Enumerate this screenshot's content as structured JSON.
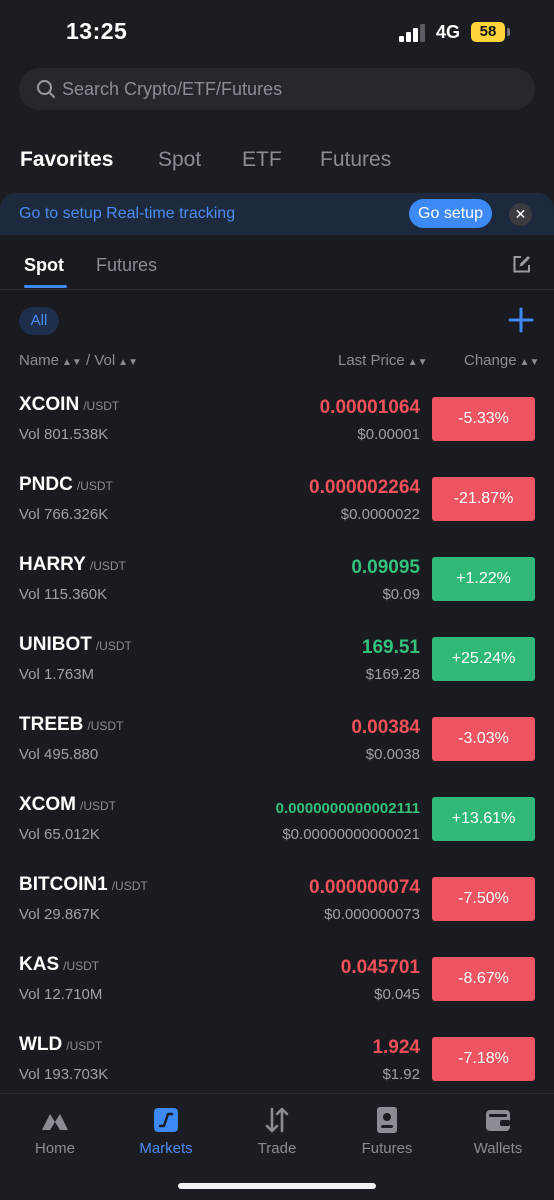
{
  "status": {
    "time": "13:25",
    "network": "4G",
    "battery": "58"
  },
  "search": {
    "placeholder": "Search Crypto/ETF/Futures"
  },
  "top_tabs": [
    {
      "label": "Favorites",
      "active": true
    },
    {
      "label": "Spot"
    },
    {
      "label": "ETF"
    },
    {
      "label": "Futures"
    }
  ],
  "banner": {
    "text": "Go to setup Real-time tracking",
    "button": "Go setup",
    "close": "✕"
  },
  "sub_tabs": [
    {
      "label": "Spot",
      "active": true
    },
    {
      "label": "Futures"
    }
  ],
  "filter": {
    "all": "All"
  },
  "columns": {
    "name": "Name",
    "vol": "/ Vol",
    "last_price": "Last Price",
    "change": "Change"
  },
  "rows": [
    {
      "symbol": "XCOIN",
      "quote": "/USDT",
      "vol": "Vol 801.538K",
      "price": "0.00001064",
      "usd": "$0.00001",
      "change": "-5.33%",
      "direction": "down"
    },
    {
      "symbol": "PNDC",
      "quote": "/USDT",
      "vol": "Vol 766.326K",
      "price": "0.000002264",
      "usd": "$0.0000022",
      "change": "-21.87%",
      "direction": "down"
    },
    {
      "symbol": "HARRY",
      "quote": "/USDT",
      "vol": "Vol 115.360K",
      "price": "0.09095",
      "usd": "$0.09",
      "change": "+1.22%",
      "direction": "up"
    },
    {
      "symbol": "UNIBOT",
      "quote": "/USDT",
      "vol": "Vol 1.763M",
      "price": "169.51",
      "usd": "$169.28",
      "change": "+25.24%",
      "direction": "up"
    },
    {
      "symbol": "TREEB",
      "quote": "/USDT",
      "vol": "Vol 495.880",
      "price": "0.00384",
      "usd": "$0.0038",
      "change": "-3.03%",
      "direction": "down"
    },
    {
      "symbol": "XCOM",
      "quote": "/USDT",
      "vol": "Vol 65.012K",
      "price": "0.0000000000002111",
      "usd": "$0.00000000000021",
      "change": "+13.61%",
      "direction": "up"
    },
    {
      "symbol": "BITCOIN1",
      "quote": "/USDT",
      "vol": "Vol 29.867K",
      "price": "0.000000074",
      "usd": "$0.000000073",
      "change": "-7.50%",
      "direction": "down"
    },
    {
      "symbol": "KAS",
      "quote": "/USDT",
      "vol": "Vol 12.710M",
      "price": "0.045701",
      "usd": "$0.045",
      "change": "-8.67%",
      "direction": "down"
    },
    {
      "symbol": "WLD",
      "quote": "/USDT",
      "vol": "Vol 193.703K",
      "price": "1.924",
      "usd": "$1.92",
      "change": "-7.18%",
      "direction": "down"
    }
  ],
  "nav": [
    {
      "label": "Home",
      "icon": "home-icon"
    },
    {
      "label": "Markets",
      "icon": "markets-icon",
      "active": true
    },
    {
      "label": "Trade",
      "icon": "trade-icon"
    },
    {
      "label": "Futures",
      "icon": "futures-icon"
    },
    {
      "label": "Wallets",
      "icon": "wallet-icon"
    }
  ],
  "colors": {
    "accent": "#3d8af7",
    "up": "#2fb877",
    "down": "#ee5560",
    "background": "#1c1d22"
  }
}
